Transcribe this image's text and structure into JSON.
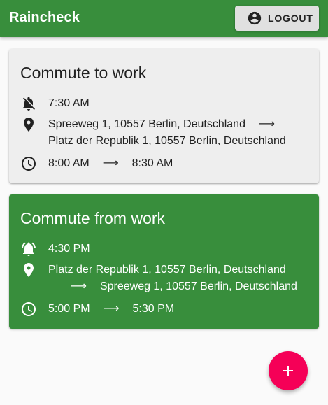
{
  "app": {
    "title": "Raincheck",
    "logout_label": "LOGOUT"
  },
  "colors": {
    "appbar": "#388e3c",
    "active_card": "#388e3c",
    "inactive_card": "#eeeeee",
    "fab": "#f50057"
  },
  "commutes": [
    {
      "title": "Commute to work",
      "alarm_state": "off",
      "alarm_icon": "notifications-off-icon",
      "alarm_time": "7:30 AM",
      "from": "Spreeweg 1, 10557 Berlin, Deutschland",
      "to": "Platz der Republik 1, 10557 Berlin, Deutschland",
      "start_time": "8:00 AM",
      "end_time": "8:30 AM",
      "arrow": "⟶",
      "active": false
    },
    {
      "title": "Commute from work",
      "alarm_state": "on",
      "alarm_icon": "notifications-active-icon",
      "alarm_time": "4:30 PM",
      "from": "Platz der Republik 1, 10557 Berlin, Deutschland",
      "to": "Spreeweg 1, 10557 Berlin, Deutschland",
      "start_time": "5:00 PM",
      "end_time": "5:30 PM",
      "arrow": "⟶",
      "active": true
    }
  ],
  "fab": {
    "icon": "add-icon"
  }
}
